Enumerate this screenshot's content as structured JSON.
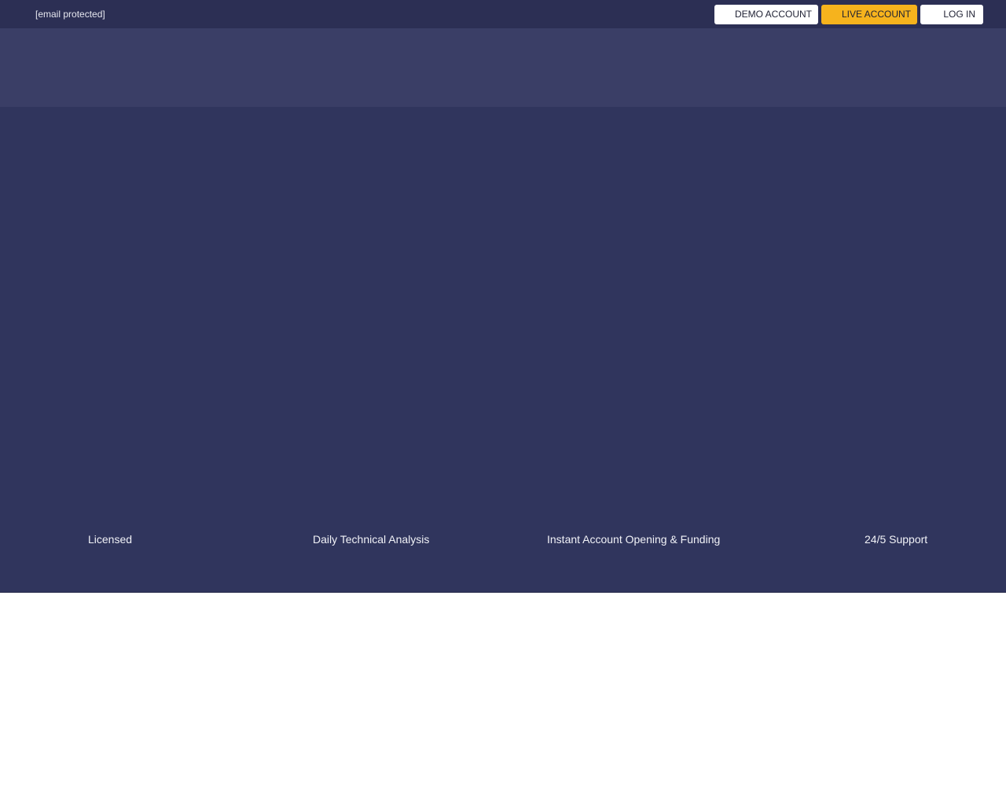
{
  "topbar": {
    "email": "[email protected]",
    "buttons": {
      "demo": "DEMO ACCOUNT",
      "live": "LIVE ACCOUNT",
      "login": "LOG IN"
    }
  },
  "features": [
    "Licensed",
    "Daily Technical Analysis",
    "Instant Account Opening & Funding",
    "24/5 Support"
  ],
  "colors": {
    "topbar": "#2c2f54",
    "navband": "#3a3e66",
    "hero": "#30355d",
    "accent": "#f6b31d"
  }
}
